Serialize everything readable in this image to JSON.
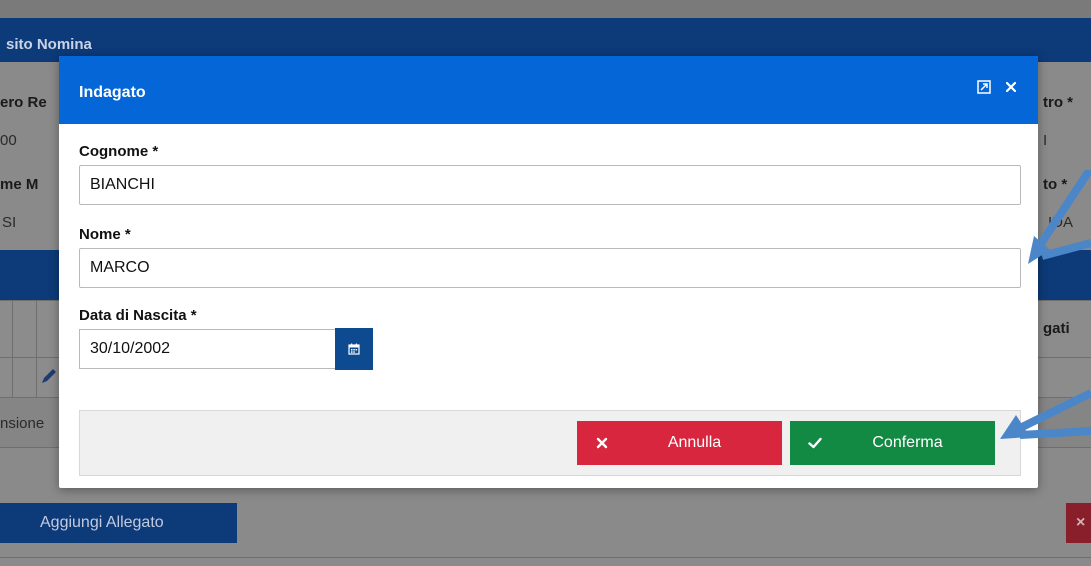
{
  "background": {
    "section_title": "sito Nomina",
    "labels": {
      "left_col_1": "ero Re",
      "left_col_2": "me M",
      "right_col_1": "tro *",
      "right_col_2": "to *",
      "right_col_3": "gati"
    },
    "values": {
      "left_col_1": "00",
      "left_col_2": "SI",
      "right_col_1": "I",
      "right_col_2": "IDA",
      "row_text": "nsione"
    },
    "add_attachment_label": "Aggiungi Allegato",
    "red_button_glyph": "×"
  },
  "modal": {
    "title": "Indagato",
    "header_icons": [
      "expand-icon",
      "close-icon"
    ],
    "fields": {
      "cognome": {
        "label": "Cognome *",
        "value": "BIANCHI"
      },
      "nome": {
        "label": "Nome *",
        "value": "MARCO"
      },
      "data_nascita": {
        "label": "Data di Nascita *",
        "value": "30/10/2002"
      }
    },
    "buttons": {
      "cancel": "Annulla",
      "confirm": "Conferma"
    }
  },
  "colors": {
    "modal_header": "#0566d8",
    "background_header": "#0d3a78",
    "cancel": "#d7263d",
    "confirm": "#128a44",
    "arrow": "#4a86c8"
  }
}
